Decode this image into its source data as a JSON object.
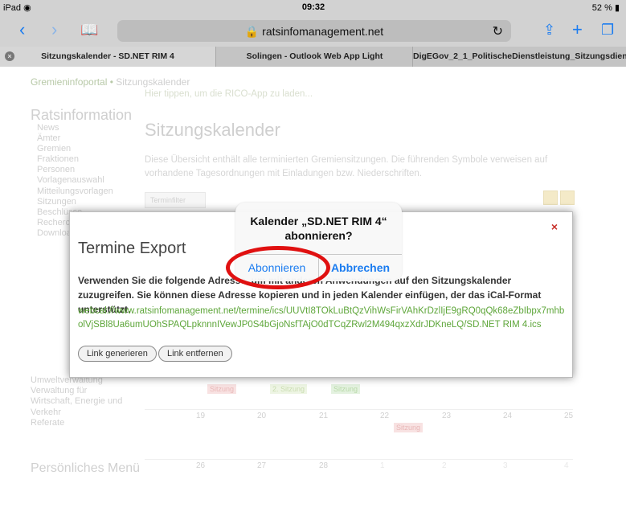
{
  "status_bar": {
    "left": "iPad",
    "time": "09:32",
    "battery": "52 %"
  },
  "browser": {
    "url": "ratsinfomanagement.net",
    "tabs": [
      {
        "label": "Sitzungskalender - SD.NET RIM 4",
        "active": true
      },
      {
        "label": "Solingen - Outlook Web App Light",
        "active": false
      },
      {
        "label": "DigEGov_2_1_PolitischeDienstleistung_Sitzungsdien...",
        "active": false
      }
    ]
  },
  "page": {
    "breadcrumb_first": "Gremieninfoportal",
    "breadcrumb_sep": "•",
    "breadcrumb_current": "Sitzungskalender",
    "subnote": "Hier tippen, um die RICO-App zu laden...",
    "sidebar_title": "Ratsinformation",
    "sidebar_items": [
      "News",
      "Ämter",
      "Gremien",
      "Fraktionen",
      "Personen",
      "Vorlagenauswahl",
      "Mitteilungsvorlagen",
      "Sitzungen",
      "Beschlüsse",
      "Recherche",
      "Downloads"
    ],
    "sidebar_sub_items": [
      "Umweltverwaltung",
      "Verwaltung für",
      "Wirtschaft, Energie und",
      "Verkehr",
      "Referate"
    ],
    "personal_menu": "Persönliches Menü",
    "title": "Sitzungskalender",
    "description": "Diese Übersicht enthält alle terminierten Gremiensitzungen. Die führenden Symbole verweisen auf vorhandene Tagesordnungen mit Einladungen bzw. Niederschriften.",
    "filter_button": "Terminfilter",
    "cal_row1": [
      "19",
      "20",
      "21",
      "22",
      "23",
      "24",
      "25"
    ],
    "cal_row2": [
      "26",
      "27",
      "28",
      "1",
      "2",
      "3",
      "4"
    ],
    "events": {
      "e1": "Sitzung",
      "e2": "2. Sitzung",
      "e3": "Sitzung",
      "e4": "Sitzung"
    }
  },
  "export_dialog": {
    "title": "Termine Export",
    "text": "Verwenden Sie die folgende Adresse, um mit anderen Anwendungen auf den Sitzungskalender zuzugreifen. Sie können diese Adresse kopieren und in jeden Kalender einfügen, der das iCal-Format unterstützt.",
    "link": "webcal://www.ratsinfomanagement.net/termine/ics/UUVtI8TOkLuBtQzVihWsFirVAhKrDzlIjE9gRQ0qQk68eZbIbpx7mhbolVjSBl8Ua6umUOhSPAQLpknnnIVewJP0S4bGjoNsfTAjO0dTCqZRwl2M494qxzXdrJDKneLQ/SD.NET RIM 4.ics",
    "btn_generate": "Link generieren",
    "btn_remove": "Link entfernen",
    "close_icon": "×"
  },
  "alert": {
    "title_line1": "Kalender „SD.NET RIM 4“",
    "title_line2": "abonnieren?",
    "subscribe": "Abonnieren",
    "cancel": "Abbrechen"
  },
  "colors": {
    "ios_blue": "#1b7cf0",
    "link_green": "#5ea63a",
    "highlight_red": "#e01010",
    "close_red": "#c8302a"
  }
}
